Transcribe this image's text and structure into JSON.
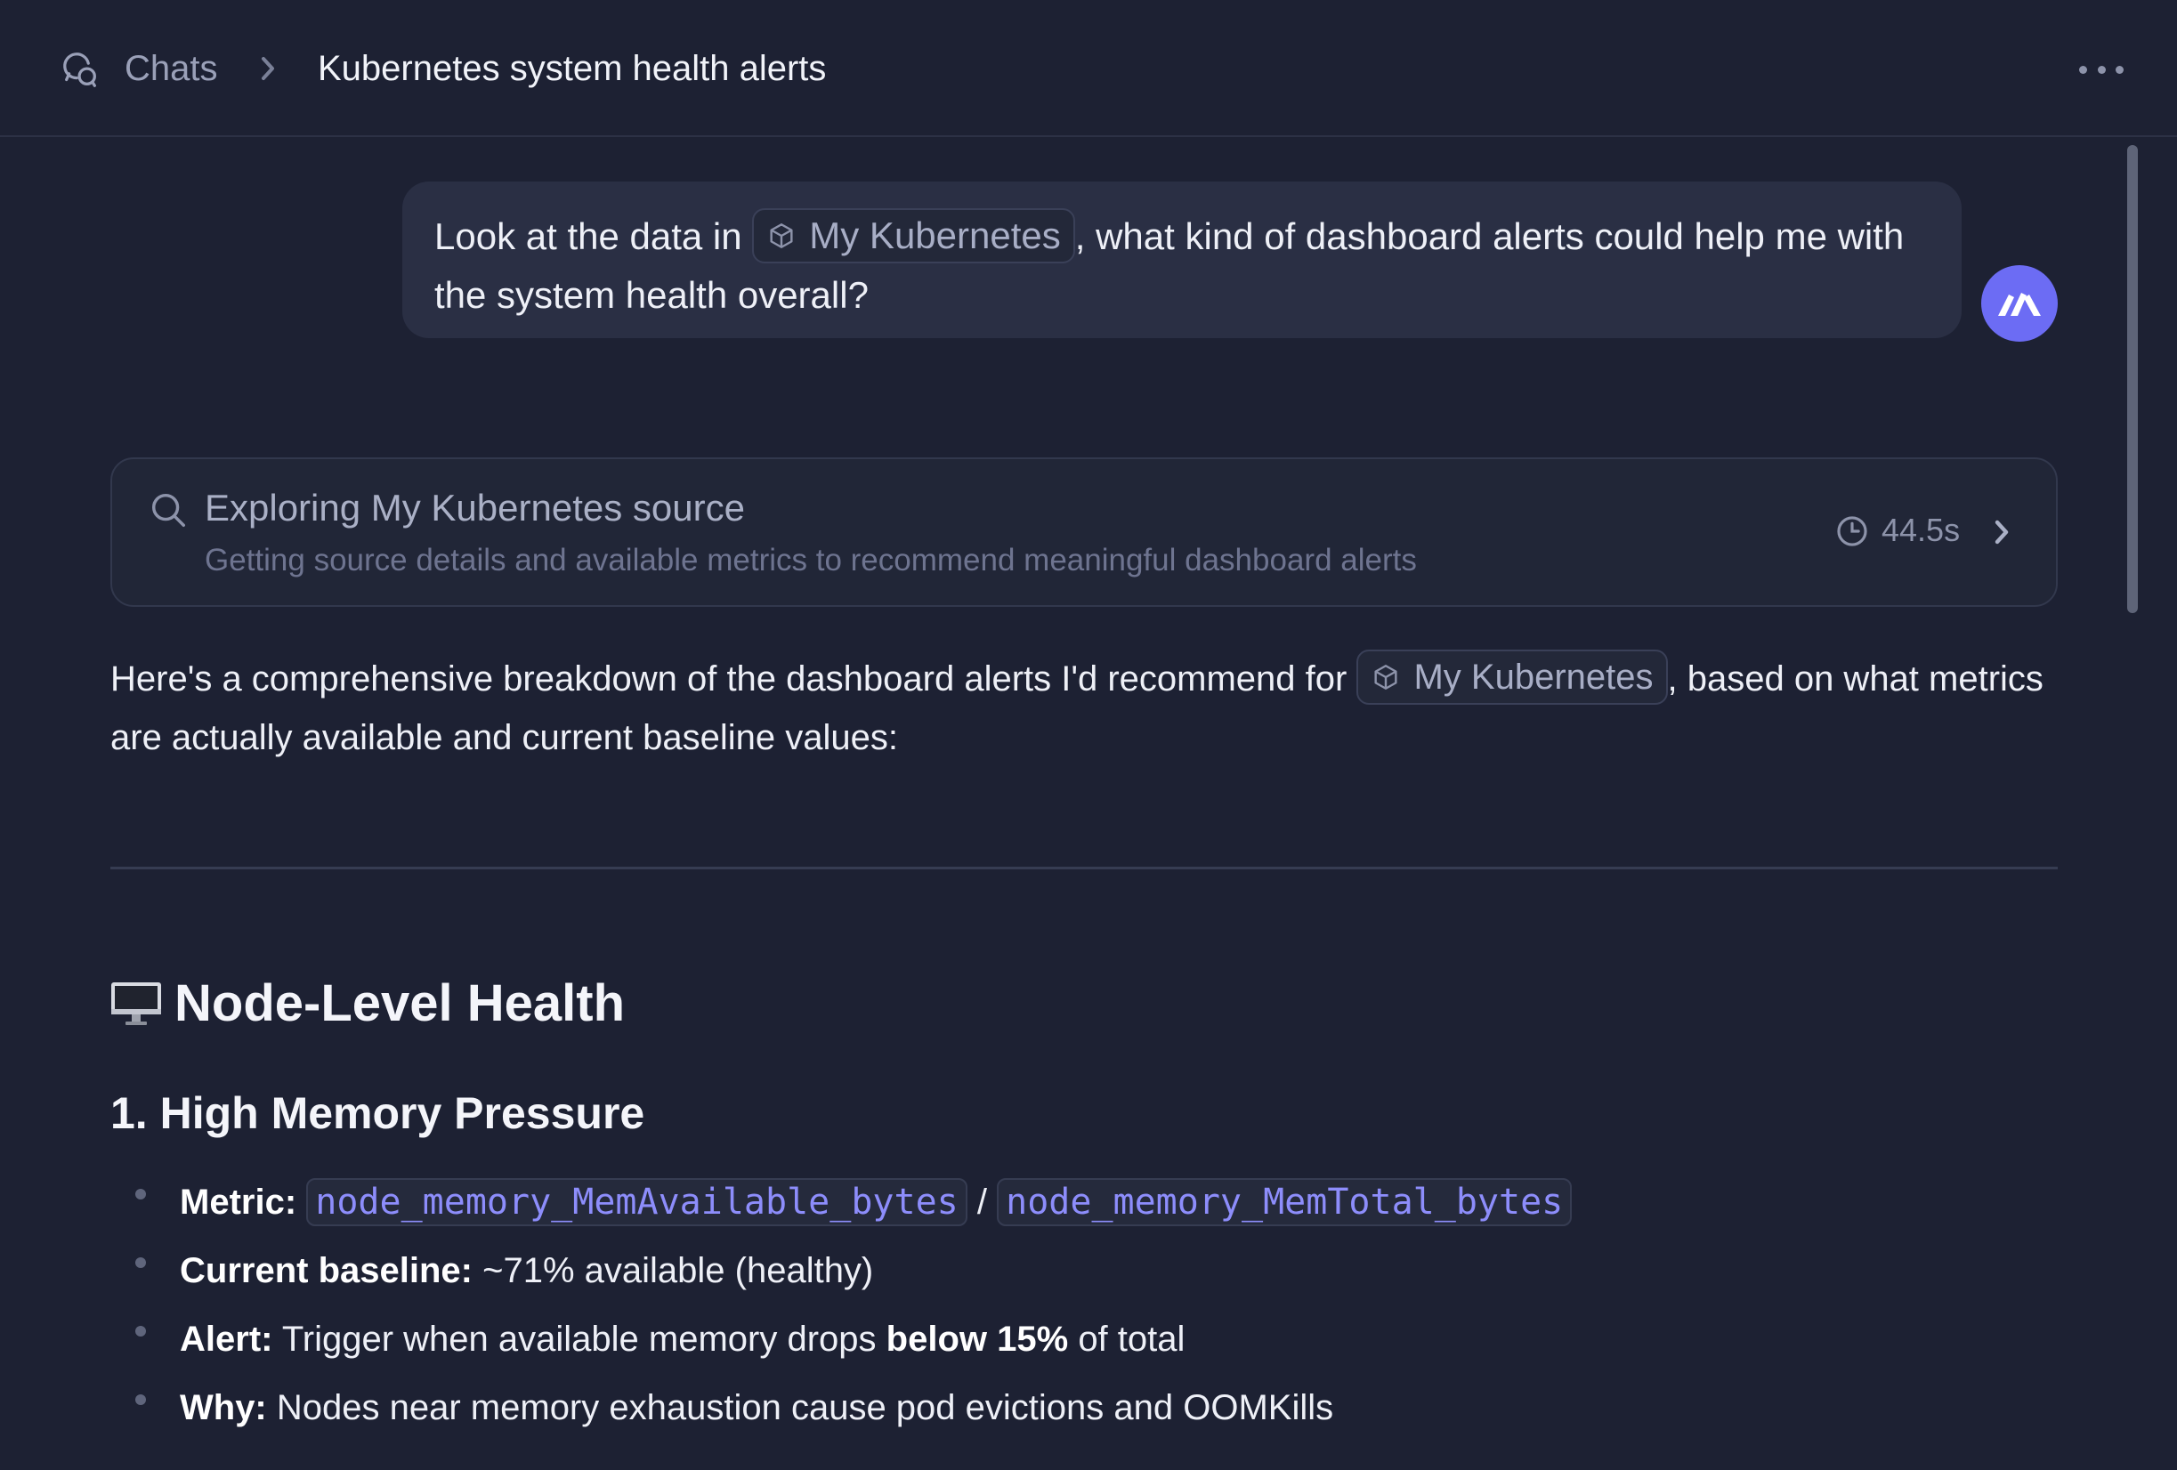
{
  "header": {
    "breadcrumb_root": "Chats",
    "title": "Kubernetes system health alerts"
  },
  "user_message": {
    "before": "Look at the data in",
    "chip": "My Kubernetes",
    "after": ", what kind of dashboard alerts could help me with the system health overall?"
  },
  "tool_call": {
    "title": "Exploring My Kubernetes source",
    "subtitle": "Getting source details and available metrics to recommend meaningful dashboard alerts",
    "duration": "44.5s"
  },
  "response": {
    "intro_before": "Here's a comprehensive breakdown of the dashboard alerts I'd recommend for",
    "intro_chip": "My Kubernetes",
    "intro_after": ", based on what metrics are actually available and current baseline values:",
    "section_heading": "Node-Level Health",
    "section_emoji": "🖥️",
    "item_heading": "1. High Memory Pressure",
    "bullets": {
      "metric_label": "Metric:",
      "metric_a": "node_memory_MemAvailable_bytes",
      "metric_sep": "/",
      "metric_b": "node_memory_MemTotal_bytes",
      "baseline_label": "Current baseline:",
      "baseline_text": "~71% available (healthy)",
      "alert_label": "Alert:",
      "alert_text": "Trigger when available memory drops",
      "alert_bold": "below 15%",
      "alert_tail": "of total",
      "why_label": "Why:",
      "why_text": "Nodes near memory exhaustion cause pod evictions and OOMKills"
    }
  },
  "colors": {
    "background": "#1d2133",
    "avatar": "#6c6cf4",
    "code_text": "#8d8dfb"
  }
}
